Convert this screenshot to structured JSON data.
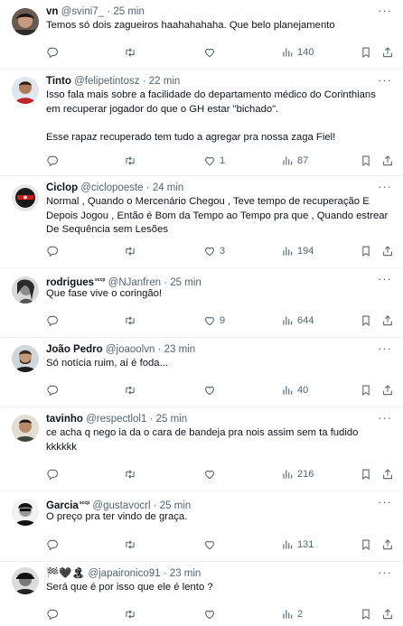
{
  "tweets": [
    {
      "name": "vn",
      "handle": "@svini7_",
      "sep": "·",
      "time": "25 min",
      "text": "Temos só dois zagueiros haahahahaha. Que belo planejamento",
      "replies": "",
      "retweets": "",
      "likes": "",
      "views": "140",
      "avatar": "avatar-dark-hair"
    },
    {
      "name": "Tinto",
      "handle": "@felipetintosz",
      "sep": "·",
      "time": "22 min",
      "text": "Isso fala mais sobre a facilidade do departamento médico do Corinthians em recuperar jogador do que o GH estar \"bichado\".\n\nEsse rapaz recuperado tem tudo a agregar pra nossa zaga Fiel!",
      "replies": "",
      "retweets": "",
      "likes": "1",
      "views": "87",
      "avatar": "avatar-red-shirt"
    },
    {
      "name": "Ciclop",
      "handle": "@ciclopoeste",
      "sep": "·",
      "time": "24 min",
      "text": "Normal , Quando o Mercenário Chegou , Teve tempo de recuperação E Depois Jogou , Então é Bom da Tempo ao Tempo pra que , Quando estrear De Sequência sem Lesões",
      "replies": "",
      "retweets": "",
      "likes": "3",
      "views": "194",
      "avatar": "avatar-masked"
    },
    {
      "name": "rodrigues",
      "badge": "sccp",
      "handle": "@NJanfren",
      "sep": "·",
      "time": "25 min",
      "text": "Que fase vive o coringão!",
      "replies": "",
      "retweets": "",
      "likes": "9",
      "views": "644",
      "avatar": "avatar-bw-woman"
    },
    {
      "name": "João Pedro",
      "handle": "@joaoolvn",
      "sep": "·",
      "time": "23 min",
      "text": "Só notícia ruim, aí é foda...",
      "replies": "",
      "retweets": "",
      "likes": "",
      "views": "40",
      "avatar": "avatar-bearded-man"
    },
    {
      "name": "tavinho",
      "handle": "@respectlol1",
      "sep": "·",
      "time": "25 min",
      "text": "ce acha q nego ia da o cara de bandeja pra nois assim sem ta fudido kkkkkk",
      "replies": "",
      "retweets": "",
      "likes": "",
      "views": "216",
      "avatar": "avatar-young-man"
    },
    {
      "name": "Garcia",
      "badge": "sccp",
      "handle": "@gustavocrl",
      "sep": "·",
      "time": "25 min",
      "text": "O preço pra ter vindo de graça.",
      "replies": "",
      "retweets": "",
      "likes": "",
      "views": "131",
      "avatar": "avatar-bw-man"
    },
    {
      "name": "🏁🖤🏝",
      "handle": "@japaironico91",
      "sep": "·",
      "time": "23 min",
      "text": "Será que é por isso que ele é lento ?",
      "replies": "",
      "retweets": "",
      "likes": "",
      "views": "2",
      "avatar": "avatar-bw-cap"
    }
  ],
  "more_glyph": "···"
}
